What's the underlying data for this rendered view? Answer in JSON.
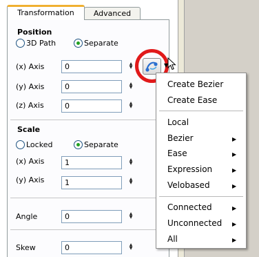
{
  "tabs": [
    {
      "label": "Transformation",
      "active": true
    },
    {
      "label": "Advanced",
      "active": false
    }
  ],
  "position": {
    "title": "Position",
    "radio_3d_path": "3D Path",
    "radio_separate": "Separate",
    "selected": "Separate",
    "fields": [
      {
        "label": "(x) Axis",
        "value": "0"
      },
      {
        "label": "(y) Axis",
        "value": "0"
      },
      {
        "label": "(z) Axis",
        "value": "0"
      }
    ]
  },
  "scale": {
    "title": "Scale",
    "radio_locked": "Locked",
    "radio_separate": "Separate",
    "selected": "Separate",
    "fields": [
      {
        "label": "(x) Axis",
        "value": "1"
      },
      {
        "label": "(y) Axis",
        "value": "1"
      }
    ]
  },
  "angle": {
    "label": "Angle",
    "value": "0"
  },
  "skew": {
    "label": "Skew",
    "value": "0"
  },
  "curve_button_icon": "curve-path-icon",
  "highlight_color": "#e11a1a",
  "context_menu": {
    "items": [
      {
        "label": "Create Bezier",
        "submenu": false
      },
      {
        "label": "Create Ease",
        "submenu": false
      },
      {
        "label": "Local",
        "submenu": false
      },
      {
        "label": "Bezier",
        "submenu": true
      },
      {
        "label": "Ease",
        "submenu": true
      },
      {
        "label": "Expression",
        "submenu": true
      },
      {
        "label": "Velobased",
        "submenu": true
      },
      {
        "label": "Connected",
        "submenu": true
      },
      {
        "label": "Unconnected",
        "submenu": true
      },
      {
        "label": "All",
        "submenu": true
      }
    ]
  }
}
